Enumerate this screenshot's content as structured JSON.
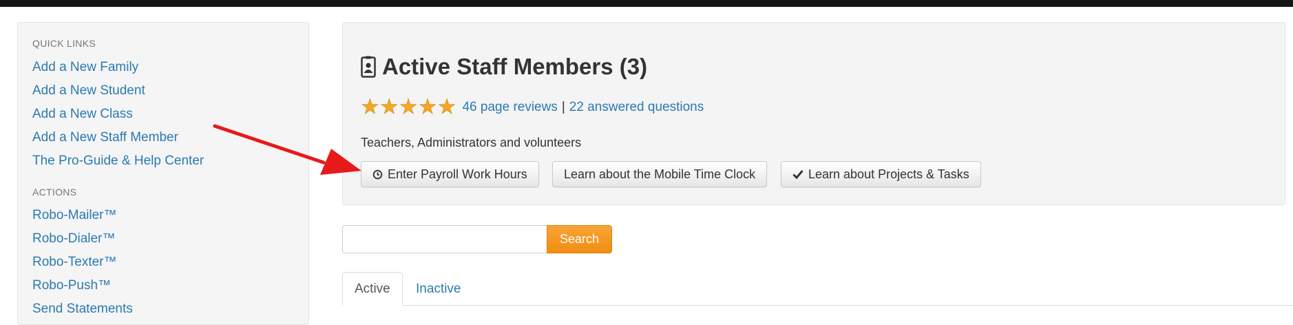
{
  "sidebar": {
    "quick_links_heading": "QUICK LINKS",
    "quick_links": [
      "Add a New Family",
      "Add a New Student",
      "Add a New Class",
      "Add a New Staff Member",
      "The Pro-Guide & Help Center"
    ],
    "actions_heading": "ACTIONS",
    "actions": [
      "Robo-Mailer™",
      "Robo-Dialer™",
      "Robo-Texter™",
      "Robo-Push™",
      "Send Statements"
    ]
  },
  "header": {
    "title": "Active Staff Members (3)",
    "title_icon": "id-badge-icon",
    "stars": "★★★★★",
    "rating": 5,
    "reviews_link": "46 page reviews",
    "separator": "|",
    "questions_link": "22 answered questions",
    "subtitle": "Teachers, Administrators and volunteers"
  },
  "buttons": {
    "payroll": {
      "label": "Enter Payroll Work Hours",
      "icon": "clock-icon"
    },
    "mobile_clock": {
      "label": "Learn about the Mobile Time Clock"
    },
    "projects": {
      "label": "Learn about Projects & Tasks",
      "icon": "checkmark-icon"
    }
  },
  "search": {
    "value": "",
    "button_label": "Search"
  },
  "tabs": [
    {
      "label": "Active",
      "active": true
    },
    {
      "label": "Inactive",
      "active": false
    }
  ],
  "colors": {
    "link": "#2a7ab0",
    "search_button": "#f39a1e",
    "annotation_arrow": "#e8191a",
    "stars": "#f5a623"
  }
}
